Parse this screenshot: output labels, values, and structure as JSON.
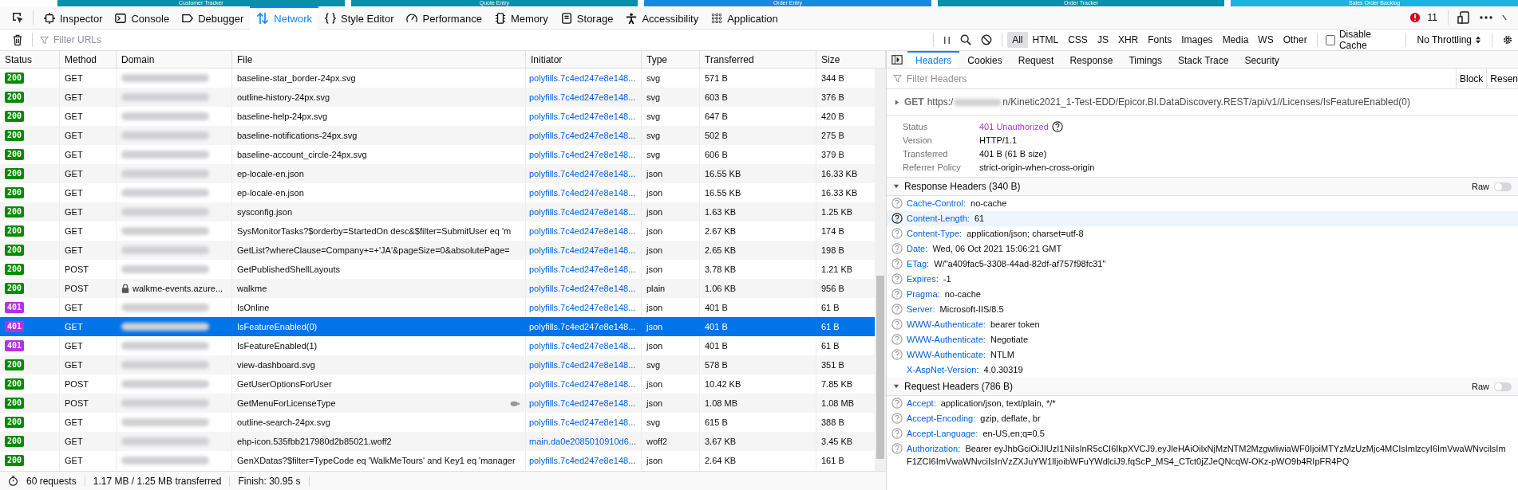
{
  "page_tabs": [
    {
      "label": "Customer Tracker",
      "color": "#0a8fa8"
    },
    {
      "label": "Quote Entry",
      "color": "#0a8fa8"
    },
    {
      "label": "Order Entry",
      "color": "#1e88d8"
    },
    {
      "label": "Order Tracker",
      "color": "#0a8fa8"
    },
    {
      "label": "Sales Order Backlog",
      "color": "#1ab3e0"
    }
  ],
  "toolbar": {
    "tabs": [
      {
        "label": "Inspector",
        "selected": false
      },
      {
        "label": "Console",
        "selected": false
      },
      {
        "label": "Debugger",
        "selected": false
      },
      {
        "label": "Network",
        "selected": true
      },
      {
        "label": "Style Editor",
        "selected": false
      },
      {
        "label": "Performance",
        "selected": false
      },
      {
        "label": "Memory",
        "selected": false
      },
      {
        "label": "Storage",
        "selected": false
      },
      {
        "label": "Accessibility",
        "selected": false
      },
      {
        "label": "Application",
        "selected": false
      }
    ],
    "error_count": "11"
  },
  "filter_bar": {
    "placeholder": "Filter URLs",
    "type_filters": [
      {
        "label": "All",
        "selected": true
      },
      {
        "label": "HTML",
        "selected": false
      },
      {
        "label": "CSS",
        "selected": false
      },
      {
        "label": "JS",
        "selected": false
      },
      {
        "label": "XHR",
        "selected": false
      },
      {
        "label": "Fonts",
        "selected": false
      },
      {
        "label": "Images",
        "selected": false
      },
      {
        "label": "Media",
        "selected": false
      },
      {
        "label": "WS",
        "selected": false
      },
      {
        "label": "Other",
        "selected": false
      }
    ],
    "disable_cache": {
      "label": "Disable Cache",
      "checked": false
    },
    "throttling": "No Throttling"
  },
  "table": {
    "columns": [
      "Status",
      "Method",
      "Domain",
      "File",
      "Initiator",
      "Type",
      "Transferred",
      "Size"
    ],
    "rows": [
      {
        "status": "200",
        "method": "GET",
        "domain": null,
        "file": "baseline-star_border-24px.svg",
        "initiator": "polyfills.7c4ed247e8e148...",
        "type": "svg",
        "transferred": "571 B",
        "size": "344 B",
        "selected": false,
        "slow": false
      },
      {
        "status": "200",
        "method": "GET",
        "domain": null,
        "file": "outline-history-24px.svg",
        "initiator": "polyfills.7c4ed247e8e148...",
        "type": "svg",
        "transferred": "603 B",
        "size": "376 B",
        "selected": false,
        "slow": false
      },
      {
        "status": "200",
        "method": "GET",
        "domain": null,
        "file": "baseline-help-24px.svg",
        "initiator": "polyfills.7c4ed247e8e148...",
        "type": "svg",
        "transferred": "647 B",
        "size": "420 B",
        "selected": false,
        "slow": false
      },
      {
        "status": "200",
        "method": "GET",
        "domain": null,
        "file": "baseline-notifications-24px.svg",
        "initiator": "polyfills.7c4ed247e8e148...",
        "type": "svg",
        "transferred": "502 B",
        "size": "275 B",
        "selected": false,
        "slow": false
      },
      {
        "status": "200",
        "method": "GET",
        "domain": null,
        "file": "baseline-account_circle-24px.svg",
        "initiator": "polyfills.7c4ed247e8e148...",
        "type": "svg",
        "transferred": "606 B",
        "size": "379 B",
        "selected": false,
        "slow": false
      },
      {
        "status": "200",
        "method": "GET",
        "domain": null,
        "file": "ep-locale-en.json",
        "initiator": "polyfills.7c4ed247e8e148...",
        "type": "json",
        "transferred": "16.55 KB",
        "size": "16.33 KB",
        "selected": false,
        "slow": false
      },
      {
        "status": "200",
        "method": "GET",
        "domain": null,
        "file": "ep-locale-en.json",
        "initiator": "polyfills.7c4ed247e8e148...",
        "type": "json",
        "transferred": "16.55 KB",
        "size": "16.33 KB",
        "selected": false,
        "slow": false
      },
      {
        "status": "200",
        "method": "GET",
        "domain": null,
        "file": "sysconfig.json",
        "initiator": "polyfills.7c4ed247e8e148...",
        "type": "json",
        "transferred": "1.63 KB",
        "size": "1.25 KB",
        "selected": false,
        "slow": false
      },
      {
        "status": "200",
        "method": "GET",
        "domain": null,
        "file": "SysMonitorTasks?$orderby=StartedOn desc&$filter=SubmitUser eq 'm",
        "initiator": "polyfills.7c4ed247e8e148...",
        "type": "json",
        "transferred": "2.67 KB",
        "size": "174 B",
        "selected": false,
        "slow": false
      },
      {
        "status": "200",
        "method": "GET",
        "domain": null,
        "file": "GetList?whereClause=Company+=+'JA'&pageSize=0&absolutePage=",
        "initiator": "polyfills.7c4ed247e8e148...",
        "type": "json",
        "transferred": "2.65 KB",
        "size": "198 B",
        "selected": false,
        "slow": false
      },
      {
        "status": "200",
        "method": "POST",
        "domain": null,
        "file": "GetPublishedShellLayouts",
        "initiator": "polyfills.7c4ed247e8e148...",
        "type": "json",
        "transferred": "3.78 KB",
        "size": "1.21 KB",
        "selected": false,
        "slow": false
      },
      {
        "status": "200",
        "method": "POST",
        "domain": "walkme-events.azure...",
        "file": "walkme",
        "initiator": "polyfills.7c4ed247e8e148...",
        "type": "plain",
        "transferred": "1.06 KB",
        "size": "956 B",
        "selected": false,
        "slow": false
      },
      {
        "status": "401",
        "method": "GET",
        "domain": null,
        "file": "IsOnline",
        "initiator": "polyfills.7c4ed247e8e148...",
        "type": "json",
        "transferred": "401 B",
        "size": "61 B",
        "selected": false,
        "slow": false
      },
      {
        "status": "401",
        "method": "GET",
        "domain": null,
        "file": "IsFeatureEnabled(0)",
        "initiator": "polyfills.7c4ed247e8e148...",
        "type": "json",
        "transferred": "401 B",
        "size": "61 B",
        "selected": true,
        "slow": false
      },
      {
        "status": "401",
        "method": "GET",
        "domain": null,
        "file": "IsFeatureEnabled(1)",
        "initiator": "polyfills.7c4ed247e8e148...",
        "type": "json",
        "transferred": "401 B",
        "size": "61 B",
        "selected": false,
        "slow": false
      },
      {
        "status": "200",
        "method": "GET",
        "domain": null,
        "file": "view-dashboard.svg",
        "initiator": "polyfills.7c4ed247e8e148...",
        "type": "svg",
        "transferred": "578 B",
        "size": "351 B",
        "selected": false,
        "slow": false
      },
      {
        "status": "200",
        "method": "POST",
        "domain": null,
        "file": "GetUserOptionsForUser",
        "initiator": "polyfills.7c4ed247e8e148...",
        "type": "json",
        "transferred": "10.42 KB",
        "size": "7.85 KB",
        "selected": false,
        "slow": false
      },
      {
        "status": "200",
        "method": "POST",
        "domain": null,
        "file": "GetMenuForLicenseType",
        "initiator": "polyfills.7c4ed247e8e148...",
        "type": "json",
        "transferred": "1.08 MB",
        "size": "1.08 MB",
        "selected": false,
        "slow": true
      },
      {
        "status": "200",
        "method": "GET",
        "domain": null,
        "file": "outline-search-24px.svg",
        "initiator": "polyfills.7c4ed247e8e148...",
        "type": "svg",
        "transferred": "615 B",
        "size": "388 B",
        "selected": false,
        "slow": false
      },
      {
        "status": "200",
        "method": "GET",
        "domain": null,
        "file": "ehp-icon.535fbb217980d2b85021.woff2",
        "initiator": "main.da0e2085010910d6...",
        "type": "woff2",
        "transferred": "3.67 KB",
        "size": "3.45 KB",
        "selected": false,
        "slow": false
      },
      {
        "status": "200",
        "method": "GET",
        "domain": null,
        "file": "GenXDatas?$filter=TypeCode eq 'WalkMeTours' and Key1 eq 'manager",
        "initiator": "polyfills.7c4ed247e8e148...",
        "type": "json",
        "transferred": "2.64 KB",
        "size": "161 B",
        "selected": false,
        "slow": false
      }
    ]
  },
  "status_bar": {
    "requests": "60 requests",
    "transferred": "1.17 MB / 1.25 MB transferred",
    "finish": "Finish: 30.95 s"
  },
  "details": {
    "tabs": [
      {
        "label": "Headers",
        "selected": true
      },
      {
        "label": "Cookies",
        "selected": false
      },
      {
        "label": "Request",
        "selected": false
      },
      {
        "label": "Response",
        "selected": false
      },
      {
        "label": "Timings",
        "selected": false
      },
      {
        "label": "Stack Trace",
        "selected": false
      },
      {
        "label": "Security",
        "selected": false
      }
    ],
    "filter_placeholder": "Filter Headers",
    "block": "Block",
    "resend": "Resen",
    "request_line": {
      "method": "GET",
      "url_start": "https:/",
      "url_end": "n/Kinetic2021_1-Test-EDD/Epicor.BI.DataDiscovery.REST/api/v1//Licenses/IsFeatureEnabled(0)"
    },
    "summary": [
      {
        "label": "Status",
        "value": "401 Unauthorized",
        "kind": "status"
      },
      {
        "label": "Version",
        "value": "HTTP/1.1",
        "kind": "text"
      },
      {
        "label": "Transferred",
        "value": "401 B (61 B size)",
        "kind": "text"
      },
      {
        "label": "Referrer Policy",
        "value": "strict-origin-when-cross-origin",
        "kind": "text"
      }
    ],
    "sections": [
      {
        "title": "Response Headers (340 B)",
        "raw_label": "Raw",
        "raw": false,
        "headers": [
          {
            "name": "Cache-Control:",
            "value": "no-cache",
            "help": true,
            "highlighted": false
          },
          {
            "name": "Content-Length:",
            "value": "61",
            "help": true,
            "highlighted": true
          },
          {
            "name": "Content-Type:",
            "value": "application/json; charset=utf-8",
            "help": true,
            "highlighted": false
          },
          {
            "name": "Date:",
            "value": "Wed, 06 Oct 2021 15:06:21 GMT",
            "help": true,
            "highlighted": false
          },
          {
            "name": "ETag:",
            "value": "W/\"a409fac5-3308-44ad-82df-af757f98fc31\"",
            "help": true,
            "highlighted": false
          },
          {
            "name": "Expires:",
            "value": "-1",
            "help": true,
            "highlighted": false
          },
          {
            "name": "Pragma:",
            "value": "no-cache",
            "help": true,
            "highlighted": false
          },
          {
            "name": "Server:",
            "value": "Microsoft-IIS/8.5",
            "help": true,
            "highlighted": false
          },
          {
            "name": "WWW-Authenticate:",
            "value": "bearer token",
            "help": true,
            "highlighted": false
          },
          {
            "name": "WWW-Authenticate:",
            "value": "Negotiate",
            "help": true,
            "highlighted": false
          },
          {
            "name": "WWW-Authenticate:",
            "value": "NTLM",
            "help": true,
            "highlighted": false
          },
          {
            "name": "X-AspNet-Version:",
            "value": "4.0.30319",
            "help": false,
            "highlighted": false
          }
        ]
      },
      {
        "title": "Request Headers (786 B)",
        "raw_label": "Raw",
        "raw": false,
        "headers": [
          {
            "name": "Accept:",
            "value": "application/json, text/plain, */*",
            "help": true,
            "highlighted": false
          },
          {
            "name": "Accept-Encoding:",
            "value": "gzip, deflate, br",
            "help": true,
            "highlighted": false
          },
          {
            "name": "Accept-Language:",
            "value": "en-US,en;q=0.5",
            "help": true,
            "highlighted": false
          },
          {
            "name": "Authorization:",
            "value": "Bearer eyJhbGciOiJIUzI1NiIsInR5cCI6IkpXVCJ9.eyJleHAiOilxNjMzNTM2MzgwliwiaWF0IjoiMTYzMzUzMjc4MCIsImlzcyI6ImVwaWNvcilsImF1ZCI6ImVwaWNvciIsInVzZXJuYW1lIjoibWFuYWdlciJ9.fqScP_MS4_CTct0jZJeQNcqW-OKz-pWO9b4RIpFR4PQ",
            "help": true,
            "highlighted": false
          }
        ]
      }
    ]
  }
}
